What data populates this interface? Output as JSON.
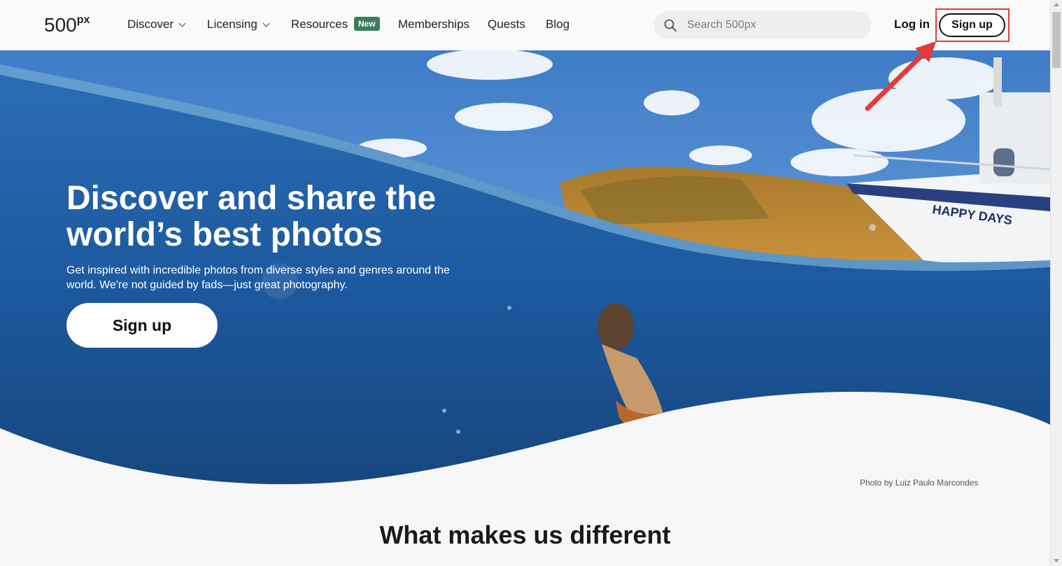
{
  "logo": {
    "main": "500",
    "suffix": "px"
  },
  "nav": {
    "discover": "Discover",
    "licensing": "Licensing",
    "resources": "Resources",
    "resources_badge": "New",
    "memberships": "Memberships",
    "quests": "Quests",
    "blog": "Blog"
  },
  "search": {
    "placeholder": "Search 500px"
  },
  "auth": {
    "login": "Log in",
    "signup": "Sign up"
  },
  "hero": {
    "title": "Discover and share the world’s best photos",
    "subtitle": "Get inspired with incredible photos from diverse styles and genres around the world. We're not guided by fads—just great photography.",
    "cta": "Sign up",
    "boat_name": "HAPPY DAYS"
  },
  "credit": "Photo by Luiz Paulo Marcondes",
  "section": {
    "title": "What makes us different"
  },
  "colors": {
    "accent_green": "#3a7d5a",
    "annotation_red": "#e53a3a",
    "sky": "#4d86c9",
    "water": "#1e5a9f"
  },
  "icons": {
    "search": "search-icon",
    "chevron": "chevron-down-icon",
    "arrow": "annotation-arrow-icon"
  }
}
